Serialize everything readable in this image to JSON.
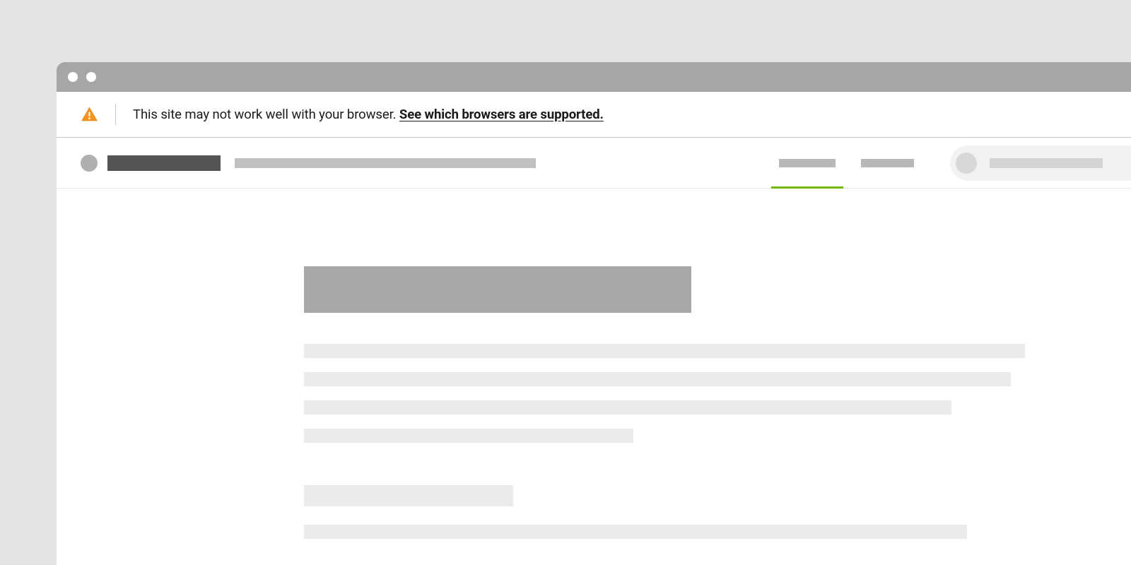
{
  "alert": {
    "message": "This site may not work well with your browser. ",
    "link_label": "See which browsers are supported."
  }
}
